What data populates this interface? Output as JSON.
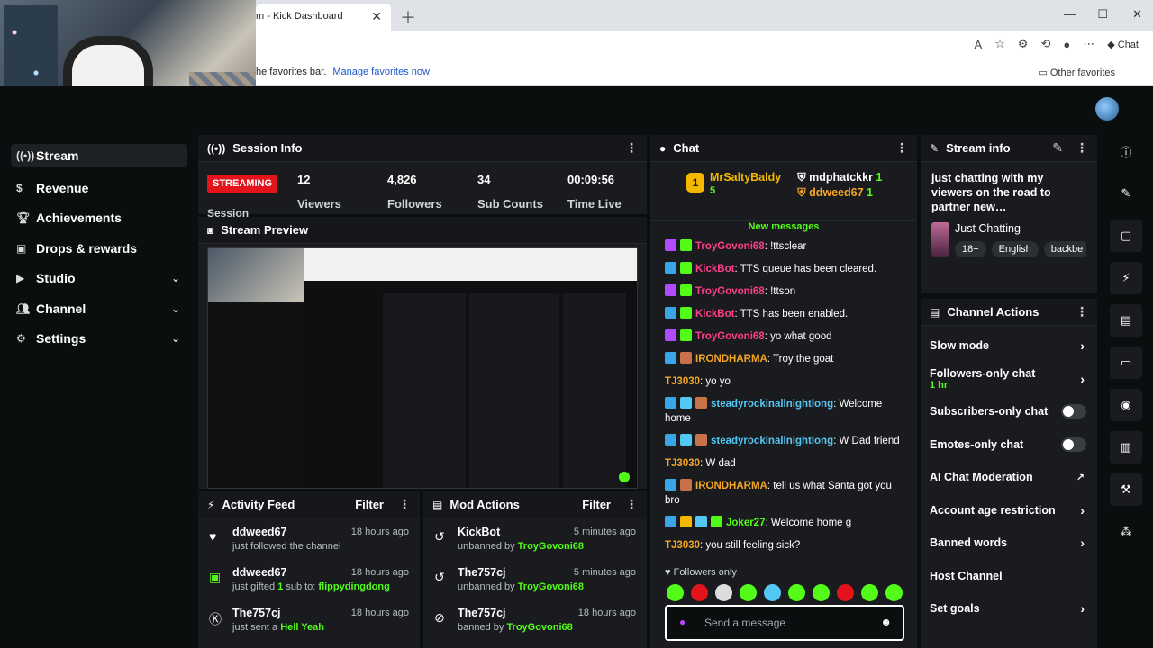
{
  "browser": {
    "tab_title": "m - Kick Dashboard",
    "favbar_text": "he favorites bar.",
    "favbar_link": "Manage favorites now",
    "other_favorites": "Other favorites",
    "chat_button": "Chat"
  },
  "sidebar": {
    "items": [
      {
        "label": "Stream",
        "icon": "broadcast-icon"
      },
      {
        "label": "Revenue",
        "icon": "dollar-icon"
      },
      {
        "label": "Achievements",
        "icon": "trophy-icon"
      },
      {
        "label": "Drops & rewards",
        "icon": "gift-icon"
      },
      {
        "label": "Studio",
        "icon": "video-icon"
      },
      {
        "label": "Channel",
        "icon": "people-icon"
      },
      {
        "label": "Settings",
        "icon": "gear-icon"
      }
    ]
  },
  "session": {
    "title": "Session Info",
    "status": "STREAMING",
    "viewers": "12",
    "viewers_label": "Viewers",
    "followers": "4,826",
    "followers_label": "Followers",
    "subs": "34",
    "subs_label": "Sub Counts",
    "time": "00:09:56",
    "time_label": "Time Live",
    "session_label": "Session"
  },
  "preview": {
    "title": "Stream Preview"
  },
  "activity": {
    "title": "Activity Feed",
    "filter": "Filter",
    "items": [
      {
        "name": "ddweed67",
        "sub": "just followed the channel",
        "time": "18 hours ago"
      },
      {
        "name": "ddweed67",
        "sub_pre": "just gifted ",
        "sub_bold": "1",
        "sub_mid": " sub to: ",
        "sub_user": "flippydingdong",
        "time": "18 hours ago"
      },
      {
        "name": "The757cj",
        "sub_pre": "just sent a ",
        "sub_user": "Hell Yeah",
        "time": "18 hours ago"
      }
    ]
  },
  "mod": {
    "title": "Mod Actions",
    "filter": "Filter",
    "items": [
      {
        "name": "KickBot",
        "action": "unbanned by ",
        "by": "TroyGovoni68",
        "time": "5 minutes ago"
      },
      {
        "name": "The757cj",
        "action": "unbanned by ",
        "by": "TroyGovoni68",
        "time": "5 minutes ago"
      },
      {
        "name": "The757cj",
        "action": "banned by ",
        "by": "TroyGovoni68",
        "time": "18 hours ago"
      }
    ]
  },
  "chat": {
    "title": "Chat",
    "top": [
      {
        "name": "MrSaltyBaldy",
        "count": "5"
      },
      {
        "name": "mdphatckkr",
        "count": "1"
      },
      {
        "name": "ddweed67",
        "count": "1"
      }
    ],
    "rank": "1",
    "new_messages": "New messages",
    "messages": [
      {
        "user": "TroyGovoni68",
        "color": "#ff3e8a",
        "text": ": !ttsclear"
      },
      {
        "user": "KickBot",
        "color": "#ff3e8a",
        "text": ": TTS queue has been cleared."
      },
      {
        "user": "TroyGovoni68",
        "color": "#ff3e8a",
        "text": ": !ttson"
      },
      {
        "user": "KickBot",
        "color": "#ff3e8a",
        "text": ": TTS has been enabled."
      },
      {
        "user": "TroyGovoni68",
        "color": "#ff3e8a",
        "text": ": yo what good"
      },
      {
        "user": "IRONDHARMA",
        "color": "#f5a623",
        "text": ": Troy the goat"
      },
      {
        "user": "TJ3030",
        "color": "#f5a623",
        "text": ": yo yo"
      },
      {
        "user": "steadyrockinallnightlong",
        "color": "#53c8f5",
        "text": ": Welcome home"
      },
      {
        "user": "steadyrockinallnightlong",
        "color": "#53c8f5",
        "text": ": W Dad friend"
      },
      {
        "user": "TJ3030",
        "color": "#f5a623",
        "text": ": W dad"
      },
      {
        "user": "IRONDHARMA",
        "color": "#f5a623",
        "text": ": tell us what Santa got you bro"
      },
      {
        "user": "Joker27",
        "color": "#53fc18",
        "text": ": Welcome home g"
      },
      {
        "user": "TJ3030",
        "color": "#f5a623",
        "text": ": you still feeling sick?"
      }
    ],
    "followers_only": "Followers only",
    "placeholder": "Send a message"
  },
  "stream_info": {
    "title": "Stream info",
    "description": "just chatting with my viewers on the road to partner new…",
    "category": "Just Chatting",
    "tags": [
      "18+",
      "English",
      "backbe"
    ]
  },
  "channel_actions": {
    "title": "Channel Actions",
    "items": [
      {
        "label": "Slow mode",
        "type": "arrow"
      },
      {
        "label": "Followers-only chat",
        "sub": "1 hr",
        "type": "arrow"
      },
      {
        "label": "Subscribers-only chat",
        "type": "toggle"
      },
      {
        "label": "Emotes-only chat",
        "type": "toggle"
      },
      {
        "label": "AI Chat Moderation",
        "type": "external"
      },
      {
        "label": "Account age restriction",
        "type": "arrow"
      },
      {
        "label": "Banned words",
        "type": "arrow"
      },
      {
        "label": "Host Channel",
        "type": "none"
      },
      {
        "label": "Set goals",
        "type": "arrow"
      }
    ]
  },
  "colors": {
    "accent": "#53fc18",
    "streaming": "#e3131b",
    "panel": "#191b1f"
  }
}
